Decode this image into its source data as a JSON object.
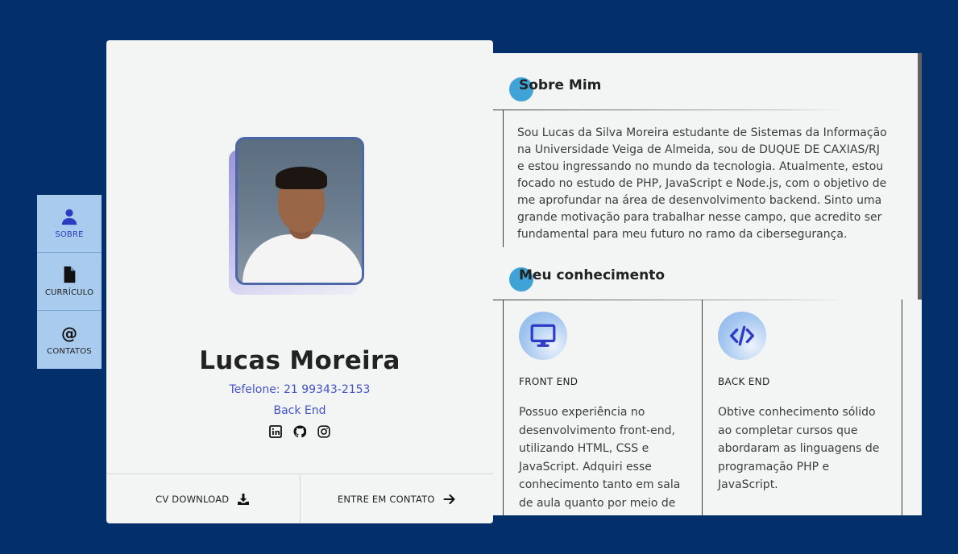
{
  "colors": {
    "background": "#03306b",
    "accent_blue": "#4353c7",
    "nav_bg": "#a8cbee",
    "dot": "#3fa3d7"
  },
  "nav": {
    "items": [
      {
        "label": "SOBRE",
        "icon": "user-icon",
        "active": true
      },
      {
        "label": "CURRÍCULO",
        "icon": "file-icon",
        "active": false
      },
      {
        "label": "CONTATOS",
        "icon": "at-icon",
        "active": false
      }
    ]
  },
  "profile": {
    "name": "Lucas Moreira",
    "phone": "Tefelone: 21 99343-2153",
    "role": "Back End",
    "socials": [
      "linkedin-icon",
      "github-icon",
      "instagram-icon"
    ],
    "actions": {
      "cv_download": "CV DOWNLOAD",
      "contact": "ENTRE EM CONTATO"
    }
  },
  "about": {
    "title": "Sobre Mim",
    "text": "Sou Lucas da Silva Moreira estudante de Sistemas da Informação na Universidade Veiga de Almeida, sou de DUQUE DE CAXIAS/RJ e estou ingressando no mundo da tecnologia. Atualmente, estou focado no estudo de PHP, JavaScript e Node.js, com o objetivo de me aprofundar na área de desenvolvimento backend. Sinto uma grande motivação para trabalhar nesse campo, que acredito ser fundamental para meu futuro no ramo da cibersegurança."
  },
  "knowledge": {
    "title": "Meu conhecimento",
    "skills": [
      {
        "icon": "monitor-icon",
        "title": "FRONT END",
        "text": "Possuo experiência no desenvolvimento front-end, utilizando HTML, CSS e JavaScript. Adquiri esse conhecimento tanto em sala de aula quanto por meio de"
      },
      {
        "icon": "code-icon",
        "title": "BACK END",
        "text": "Obtive conhecimento sólido ao completar cursos que abordaram as linguagens de programação PHP e JavaScript."
      }
    ]
  }
}
